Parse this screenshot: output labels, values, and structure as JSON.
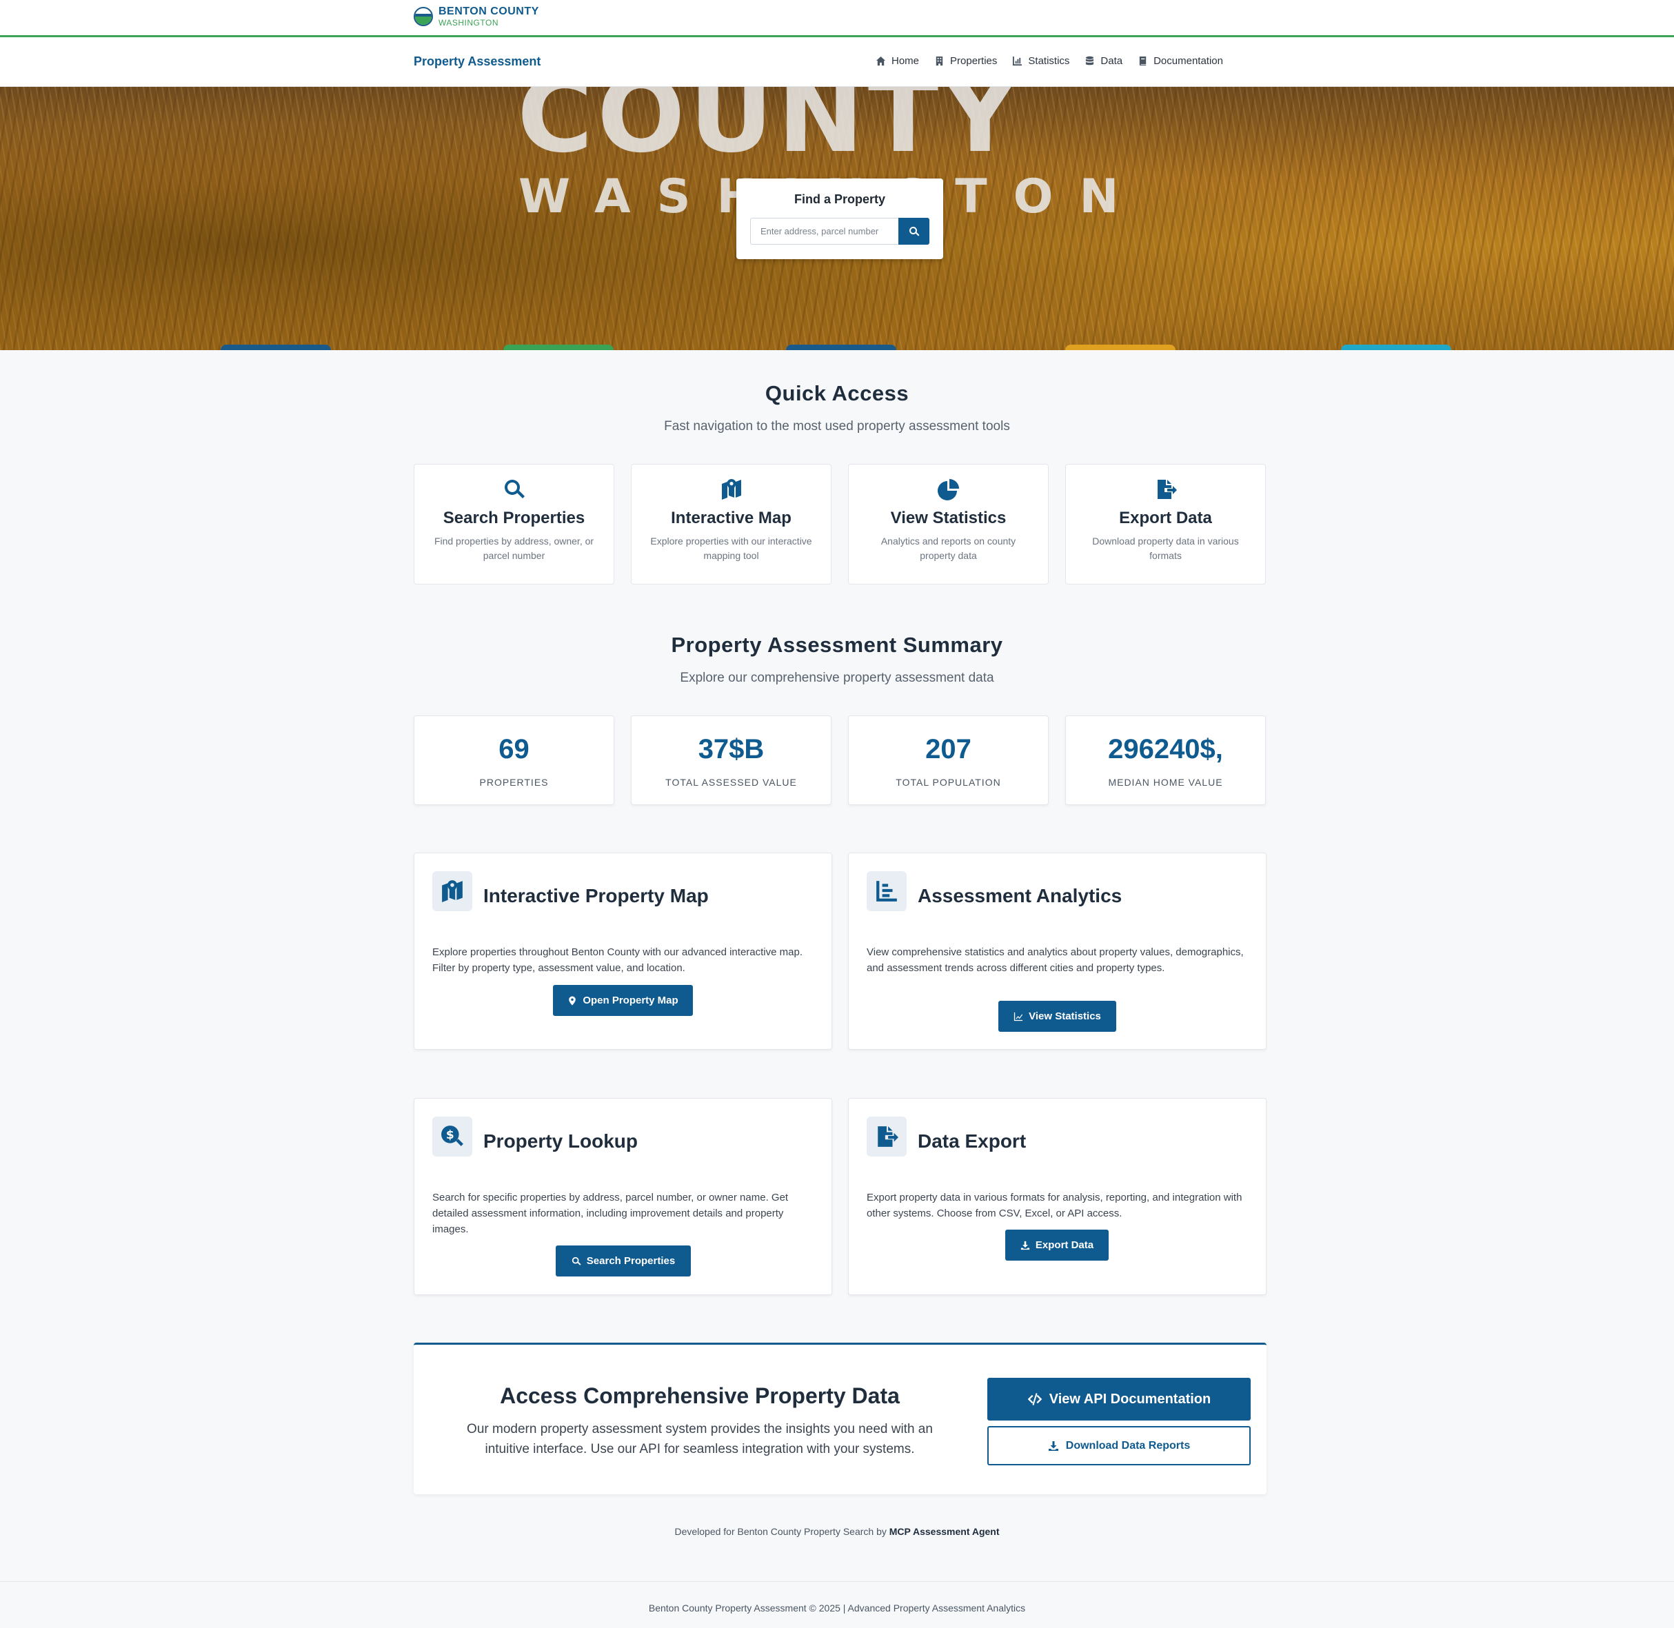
{
  "logo": {
    "title": "BENTON COUNTY",
    "subtitle": "WASHINGTON"
  },
  "nav": {
    "brand": "Property Assessment",
    "links": [
      {
        "label": "Home",
        "icon": "home-icon"
      },
      {
        "label": "Properties",
        "icon": "building-icon"
      },
      {
        "label": "Statistics",
        "icon": "chart-icon"
      },
      {
        "label": "Data",
        "icon": "database-icon"
      },
      {
        "label": "Documentation",
        "icon": "book-icon"
      }
    ]
  },
  "hero": {
    "word1": "COUNTY",
    "word2": "WASHINGTON",
    "find_title": "Find a Property",
    "search_placeholder": "Enter address, parcel number",
    "search_value": "",
    "tab_colors": [
      "#1a5a8a",
      "#3aa356",
      "#1a5a8a",
      "#e0a020",
      "#20a8c8"
    ]
  },
  "quick_access": {
    "title": "Quick Access",
    "subtitle": "Fast navigation to the most used property assessment tools",
    "cards": [
      {
        "title": "Search Properties",
        "desc": "Find properties by address, owner, or parcel number",
        "icon": "search-icon"
      },
      {
        "title": "Interactive Map",
        "desc": "Explore properties with our interactive mapping tool",
        "icon": "map-icon"
      },
      {
        "title": "View Statistics",
        "desc": "Analytics and reports on county property data",
        "icon": "pie-chart-icon"
      },
      {
        "title": "Export Data",
        "desc": "Download property data in various formats",
        "icon": "file-export-icon"
      }
    ]
  },
  "summary": {
    "title": "Property Assessment Summary",
    "subtitle": "Explore our comprehensive property assessment data",
    "stats": [
      {
        "value": "69",
        "label": "PROPERTIES"
      },
      {
        "value": "37$B",
        "label": "TOTAL ASSESSED VALUE"
      },
      {
        "value": "207",
        "label": "TOTAL POPULATION"
      },
      {
        "value": "296240$,",
        "label": "MEDIAN HOME VALUE"
      }
    ]
  },
  "features": [
    {
      "title": "Interactive Property Map",
      "desc": "Explore properties throughout Benton County with our advanced interactive map. Filter by property type, assessment value, and location.",
      "button": "Open Property Map",
      "icon": "map-icon",
      "button_icon": "map-marker-icon"
    },
    {
      "title": "Assessment Analytics",
      "desc": "View comprehensive statistics and analytics about property values, demographics, and assessment trends across different cities and property types.",
      "button": "View Statistics",
      "icon": "bar-chart-icon",
      "button_icon": "line-chart-icon"
    },
    {
      "title": "Property Lookup",
      "desc": "Search for specific properties by address, parcel number, or owner name. Get detailed assessment information, including improvement details and property images.",
      "button": "Search Properties",
      "icon": "search-dollar-icon",
      "button_icon": "search-icon"
    },
    {
      "title": "Data Export",
      "desc": "Export property data in various formats for analysis, reporting, and integration with other systems. Choose from CSV, Excel, or API access.",
      "button": "Export Data",
      "icon": "file-export-icon",
      "button_icon": "download-icon"
    }
  ],
  "cta": {
    "title": "Access Comprehensive Property Data",
    "text": "Our modern property assessment system provides the insights you need with an intuitive interface. Use our API for seamless integration with your systems.",
    "button_primary": "View API Documentation",
    "button_secondary": "Download Data Reports"
  },
  "credit": {
    "prefix": "Developed for Benton County Property Search by ",
    "name": "MCP Assessment Agent"
  },
  "footer": {
    "text": "Benton County Property Assessment © 2025 | Advanced Property Assessment Analytics"
  },
  "colors": {
    "primary": "#0f5a8e",
    "accent_green": "#3aa356"
  }
}
